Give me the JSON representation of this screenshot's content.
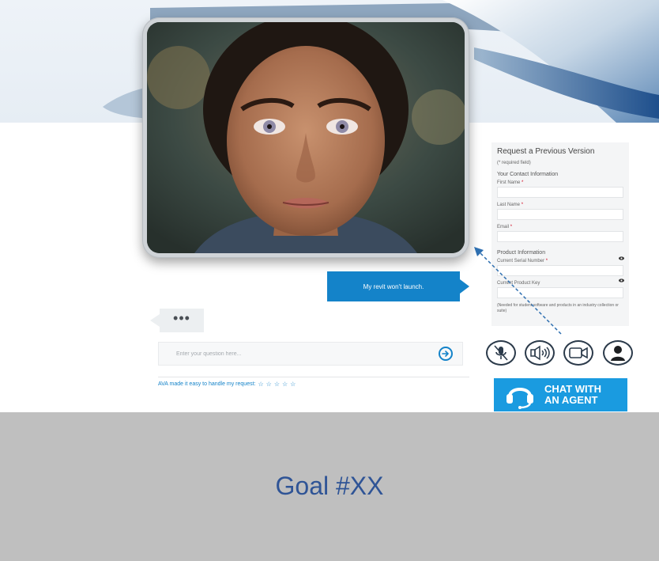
{
  "form": {
    "title": "Request a Previous Version",
    "required_note": "(* required field)",
    "contact_section": "Your Contact Information",
    "first_name_label": "First Name",
    "last_name_label": "Last Name",
    "email_label": "Email",
    "required_mark": "*",
    "product_section": "Product Information",
    "serial_label": "Current Serial Number",
    "product_key_label": "Current Product Key",
    "note": "(Needed for student software and products in an industry collection or suite)"
  },
  "chat": {
    "user_message": "My revit won't launch.",
    "typing_indicator": "•••",
    "question_placeholder": "Enter your question here...",
    "rating_text": "AVA made it easy to handle my request:",
    "rating_stars": [
      "☆",
      "☆",
      "☆",
      "☆",
      "☆"
    ]
  },
  "controls": {
    "mic_icon": "muted-microphone-icon",
    "speaker_icon": "speaker-icon",
    "video_icon": "video-camera-icon",
    "agent_icon": "user-icon"
  },
  "chat_agent_button": {
    "label": "CHAT WITH AN AGENT"
  },
  "caption": {
    "text": "Goal #XX"
  },
  "colors": {
    "accent": "#1483c9",
    "agent_button": "#1a9be0",
    "caption_bg": "#bfbfbf",
    "caption_text": "#2f5496"
  }
}
